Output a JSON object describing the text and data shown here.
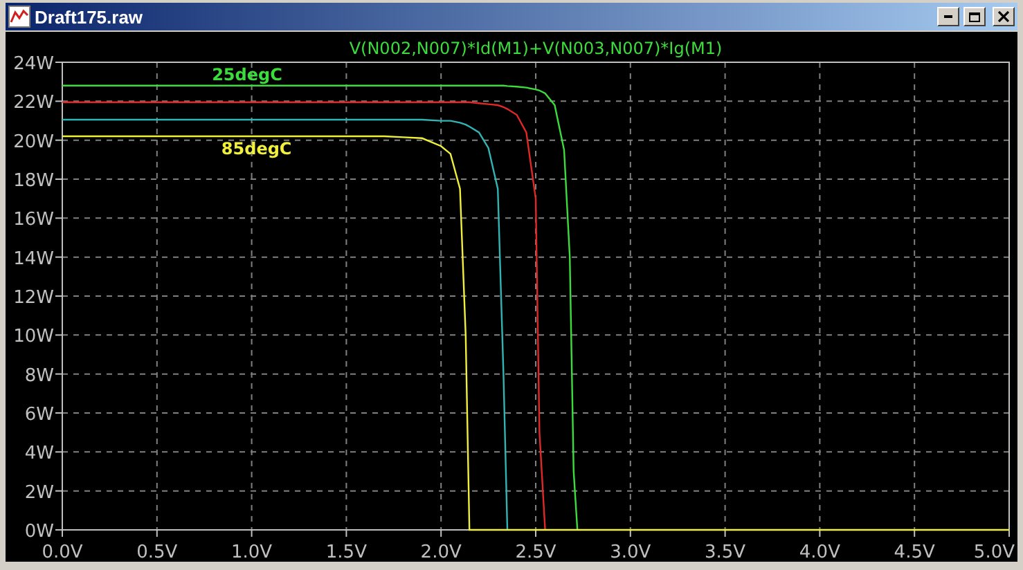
{
  "window": {
    "title": "Draft175.raw"
  },
  "plot": {
    "chart_data": {
      "type": "line",
      "title": "V(N002,N007)*Id(M1)+V(N003,N007)*Ig(M1)",
      "x": [
        0,
        0.5,
        1.0,
        1.5,
        1.7,
        1.8,
        1.9,
        2.0,
        2.05,
        2.1,
        2.13,
        2.15,
        2.2,
        2.25,
        2.3,
        2.33,
        2.35,
        2.4,
        2.45,
        2.5,
        2.52,
        2.55,
        2.6,
        2.65,
        2.68,
        2.7,
        2.72,
        2.8,
        5.0
      ],
      "series": [
        {
          "name": "25degC",
          "color": "#3cdc3c",
          "values": [
            22.8,
            22.8,
            22.8,
            22.8,
            22.8,
            22.8,
            22.8,
            22.8,
            22.8,
            22.8,
            22.8,
            22.8,
            22.8,
            22.8,
            22.8,
            22.8,
            22.78,
            22.75,
            22.7,
            22.6,
            22.55,
            22.4,
            21.8,
            19.5,
            14,
            3,
            0,
            null,
            null
          ]
        },
        {
          "color": "#e02828",
          "values": [
            21.95,
            21.95,
            21.95,
            21.95,
            21.95,
            21.95,
            21.95,
            21.95,
            21.95,
            21.95,
            21.95,
            21.95,
            21.9,
            21.85,
            21.8,
            21.7,
            21.6,
            21.3,
            20.4,
            17,
            5,
            0,
            null,
            null,
            null,
            null,
            null,
            null,
            null
          ]
        },
        {
          "color": "#30b4b4",
          "values": [
            21.05,
            21.05,
            21.05,
            21.05,
            21.05,
            21.05,
            21.05,
            21.0,
            21.0,
            20.9,
            20.8,
            20.7,
            20.4,
            19.6,
            17.5,
            8,
            0,
            null,
            null,
            null,
            null,
            null,
            null,
            null,
            null,
            null,
            null,
            null,
            null
          ]
        },
        {
          "name": "85degC",
          "color": "#f0f03c",
          "values": [
            20.2,
            20.2,
            20.2,
            20.2,
            20.2,
            20.15,
            20.1,
            19.7,
            19.3,
            17.5,
            10,
            0,
            0,
            0,
            0,
            0,
            0,
            0,
            0,
            0,
            0,
            0,
            0,
            0,
            0,
            0,
            0,
            0,
            0
          ]
        }
      ],
      "grid": true,
      "xlim": [
        0,
        5
      ],
      "ylim": [
        0,
        24
      ],
      "xticks": [
        {
          "value": 0,
          "label": "0.0V"
        },
        {
          "value": 0.5,
          "label": "0.5V"
        },
        {
          "value": 1,
          "label": "1.0V"
        },
        {
          "value": 1.5,
          "label": "1.5V"
        },
        {
          "value": 2,
          "label": "2.0V"
        },
        {
          "value": 2.5,
          "label": "2.5V"
        },
        {
          "value": 3,
          "label": "3.0V"
        },
        {
          "value": 3.5,
          "label": "3.5V"
        },
        {
          "value": 4,
          "label": "4.0V"
        },
        {
          "value": 4.5,
          "label": "4.5V"
        },
        {
          "value": 5,
          "label": "5.0V"
        }
      ],
      "yticks": [
        {
          "value": 0,
          "label": "0W"
        },
        {
          "value": 2,
          "label": "2W"
        },
        {
          "value": 4,
          "label": "4W"
        },
        {
          "value": 6,
          "label": "6W"
        },
        {
          "value": 8,
          "label": "8W"
        },
        {
          "value": 10,
          "label": "10W"
        },
        {
          "value": 12,
          "label": "12W"
        },
        {
          "value": 14,
          "label": "14W"
        },
        {
          "value": 16,
          "label": "16W"
        },
        {
          "value": 18,
          "label": "18W"
        },
        {
          "value": 20,
          "label": "20W"
        },
        {
          "value": 22,
          "label": "22W"
        },
        {
          "value": 24,
          "label": "24W"
        }
      ]
    }
  }
}
